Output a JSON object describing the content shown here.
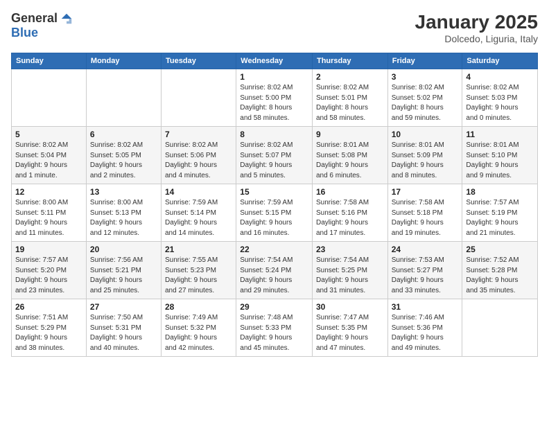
{
  "header": {
    "logo_general": "General",
    "logo_blue": "Blue",
    "month": "January 2025",
    "location": "Dolcedo, Liguria, Italy"
  },
  "weekdays": [
    "Sunday",
    "Monday",
    "Tuesday",
    "Wednesday",
    "Thursday",
    "Friday",
    "Saturday"
  ],
  "weeks": [
    [
      {
        "day": "",
        "info": ""
      },
      {
        "day": "",
        "info": ""
      },
      {
        "day": "",
        "info": ""
      },
      {
        "day": "1",
        "info": "Sunrise: 8:02 AM\nSunset: 5:00 PM\nDaylight: 8 hours\nand 58 minutes."
      },
      {
        "day": "2",
        "info": "Sunrise: 8:02 AM\nSunset: 5:01 PM\nDaylight: 8 hours\nand 58 minutes."
      },
      {
        "day": "3",
        "info": "Sunrise: 8:02 AM\nSunset: 5:02 PM\nDaylight: 8 hours\nand 59 minutes."
      },
      {
        "day": "4",
        "info": "Sunrise: 8:02 AM\nSunset: 5:03 PM\nDaylight: 9 hours\nand 0 minutes."
      }
    ],
    [
      {
        "day": "5",
        "info": "Sunrise: 8:02 AM\nSunset: 5:04 PM\nDaylight: 9 hours\nand 1 minute."
      },
      {
        "day": "6",
        "info": "Sunrise: 8:02 AM\nSunset: 5:05 PM\nDaylight: 9 hours\nand 2 minutes."
      },
      {
        "day": "7",
        "info": "Sunrise: 8:02 AM\nSunset: 5:06 PM\nDaylight: 9 hours\nand 4 minutes."
      },
      {
        "day": "8",
        "info": "Sunrise: 8:02 AM\nSunset: 5:07 PM\nDaylight: 9 hours\nand 5 minutes."
      },
      {
        "day": "9",
        "info": "Sunrise: 8:01 AM\nSunset: 5:08 PM\nDaylight: 9 hours\nand 6 minutes."
      },
      {
        "day": "10",
        "info": "Sunrise: 8:01 AM\nSunset: 5:09 PM\nDaylight: 9 hours\nand 8 minutes."
      },
      {
        "day": "11",
        "info": "Sunrise: 8:01 AM\nSunset: 5:10 PM\nDaylight: 9 hours\nand 9 minutes."
      }
    ],
    [
      {
        "day": "12",
        "info": "Sunrise: 8:00 AM\nSunset: 5:11 PM\nDaylight: 9 hours\nand 11 minutes."
      },
      {
        "day": "13",
        "info": "Sunrise: 8:00 AM\nSunset: 5:13 PM\nDaylight: 9 hours\nand 12 minutes."
      },
      {
        "day": "14",
        "info": "Sunrise: 7:59 AM\nSunset: 5:14 PM\nDaylight: 9 hours\nand 14 minutes."
      },
      {
        "day": "15",
        "info": "Sunrise: 7:59 AM\nSunset: 5:15 PM\nDaylight: 9 hours\nand 16 minutes."
      },
      {
        "day": "16",
        "info": "Sunrise: 7:58 AM\nSunset: 5:16 PM\nDaylight: 9 hours\nand 17 minutes."
      },
      {
        "day": "17",
        "info": "Sunrise: 7:58 AM\nSunset: 5:18 PM\nDaylight: 9 hours\nand 19 minutes."
      },
      {
        "day": "18",
        "info": "Sunrise: 7:57 AM\nSunset: 5:19 PM\nDaylight: 9 hours\nand 21 minutes."
      }
    ],
    [
      {
        "day": "19",
        "info": "Sunrise: 7:57 AM\nSunset: 5:20 PM\nDaylight: 9 hours\nand 23 minutes."
      },
      {
        "day": "20",
        "info": "Sunrise: 7:56 AM\nSunset: 5:21 PM\nDaylight: 9 hours\nand 25 minutes."
      },
      {
        "day": "21",
        "info": "Sunrise: 7:55 AM\nSunset: 5:23 PM\nDaylight: 9 hours\nand 27 minutes."
      },
      {
        "day": "22",
        "info": "Sunrise: 7:54 AM\nSunset: 5:24 PM\nDaylight: 9 hours\nand 29 minutes."
      },
      {
        "day": "23",
        "info": "Sunrise: 7:54 AM\nSunset: 5:25 PM\nDaylight: 9 hours\nand 31 minutes."
      },
      {
        "day": "24",
        "info": "Sunrise: 7:53 AM\nSunset: 5:27 PM\nDaylight: 9 hours\nand 33 minutes."
      },
      {
        "day": "25",
        "info": "Sunrise: 7:52 AM\nSunset: 5:28 PM\nDaylight: 9 hours\nand 35 minutes."
      }
    ],
    [
      {
        "day": "26",
        "info": "Sunrise: 7:51 AM\nSunset: 5:29 PM\nDaylight: 9 hours\nand 38 minutes."
      },
      {
        "day": "27",
        "info": "Sunrise: 7:50 AM\nSunset: 5:31 PM\nDaylight: 9 hours\nand 40 minutes."
      },
      {
        "day": "28",
        "info": "Sunrise: 7:49 AM\nSunset: 5:32 PM\nDaylight: 9 hours\nand 42 minutes."
      },
      {
        "day": "29",
        "info": "Sunrise: 7:48 AM\nSunset: 5:33 PM\nDaylight: 9 hours\nand 45 minutes."
      },
      {
        "day": "30",
        "info": "Sunrise: 7:47 AM\nSunset: 5:35 PM\nDaylight: 9 hours\nand 47 minutes."
      },
      {
        "day": "31",
        "info": "Sunrise: 7:46 AM\nSunset: 5:36 PM\nDaylight: 9 hours\nand 49 minutes."
      },
      {
        "day": "",
        "info": ""
      }
    ]
  ]
}
